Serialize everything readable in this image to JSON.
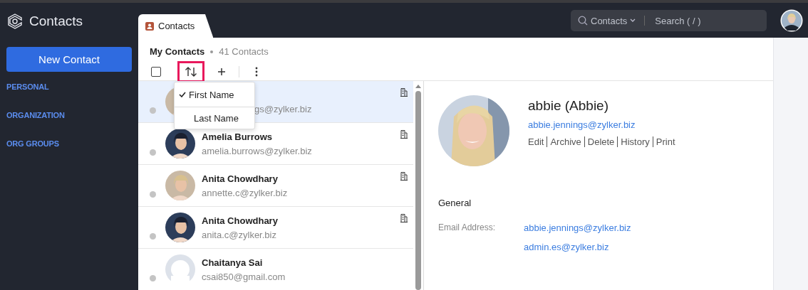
{
  "app": {
    "title": "Contacts"
  },
  "sidebar": {
    "new_button": "New Contact",
    "items": [
      {
        "label": "PERSONAL"
      },
      {
        "label": "ORGANIZATION"
      },
      {
        "label": "ORG GROUPS"
      }
    ]
  },
  "tab": {
    "label": "Contacts",
    "selected": true
  },
  "search": {
    "scope": "Contacts",
    "placeholder": "Search ( / )"
  },
  "list": {
    "title": "My Contacts",
    "count": "41 Contacts",
    "sort_highlighted": true,
    "select_all_checked": false,
    "rows": [
      {
        "email": "gs@zylker.biz",
        "selected": true
      },
      {
        "name": "Amelia Burrows",
        "email": "amelia.burrows@zylker.biz",
        "selected": false
      },
      {
        "name": "Anita Chowdhary",
        "email": "annette.c@zylker.biz",
        "selected": false
      },
      {
        "name": "Anita Chowdhary",
        "email": "anita.c@zylker.biz",
        "selected": false
      },
      {
        "kind": "placeholder",
        "name": "Chaitanya Sai",
        "email": "csai850@gmail.com",
        "selected": false
      }
    ]
  },
  "sort_menu": {
    "options": [
      {
        "label": "First Name",
        "selected": true
      },
      {
        "label": "Last Name",
        "selected": false
      }
    ]
  },
  "detail": {
    "name": "abbie (Abbie)",
    "email": "abbie.jennings@zylker.biz",
    "actions": [
      "Edit",
      "Archive",
      "Delete",
      "History",
      "Print"
    ],
    "section": "General",
    "field_label": "Email Address:",
    "field_values": [
      "abbie.jennings@zylker.biz",
      "admin.es@zylker.biz"
    ]
  }
}
